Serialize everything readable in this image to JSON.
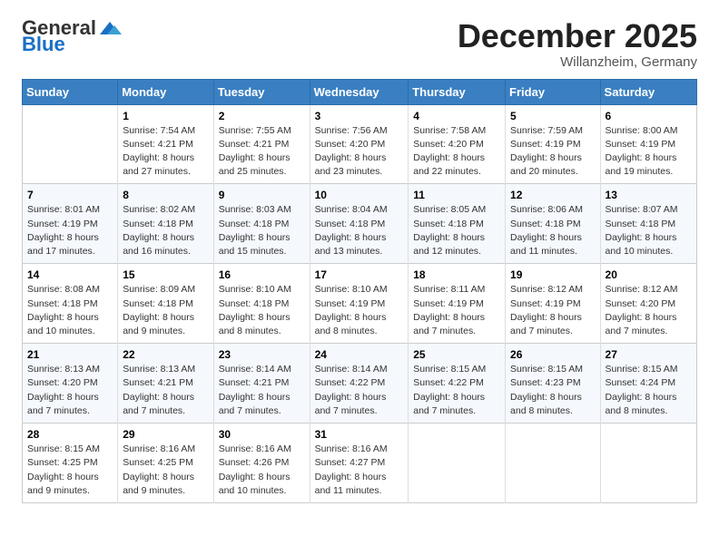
{
  "header": {
    "logo_general": "General",
    "logo_blue": "Blue",
    "month_title": "December 2025",
    "location": "Willanzheim, Germany"
  },
  "days_of_week": [
    "Sunday",
    "Monday",
    "Tuesday",
    "Wednesday",
    "Thursday",
    "Friday",
    "Saturday"
  ],
  "weeks": [
    [
      {
        "day": "",
        "sunrise": "",
        "sunset": "",
        "daylight": ""
      },
      {
        "day": "1",
        "sunrise": "Sunrise: 7:54 AM",
        "sunset": "Sunset: 4:21 PM",
        "daylight": "Daylight: 8 hours and 27 minutes."
      },
      {
        "day": "2",
        "sunrise": "Sunrise: 7:55 AM",
        "sunset": "Sunset: 4:21 PM",
        "daylight": "Daylight: 8 hours and 25 minutes."
      },
      {
        "day": "3",
        "sunrise": "Sunrise: 7:56 AM",
        "sunset": "Sunset: 4:20 PM",
        "daylight": "Daylight: 8 hours and 23 minutes."
      },
      {
        "day": "4",
        "sunrise": "Sunrise: 7:58 AM",
        "sunset": "Sunset: 4:20 PM",
        "daylight": "Daylight: 8 hours and 22 minutes."
      },
      {
        "day": "5",
        "sunrise": "Sunrise: 7:59 AM",
        "sunset": "Sunset: 4:19 PM",
        "daylight": "Daylight: 8 hours and 20 minutes."
      },
      {
        "day": "6",
        "sunrise": "Sunrise: 8:00 AM",
        "sunset": "Sunset: 4:19 PM",
        "daylight": "Daylight: 8 hours and 19 minutes."
      }
    ],
    [
      {
        "day": "7",
        "sunrise": "Sunrise: 8:01 AM",
        "sunset": "Sunset: 4:19 PM",
        "daylight": "Daylight: 8 hours and 17 minutes."
      },
      {
        "day": "8",
        "sunrise": "Sunrise: 8:02 AM",
        "sunset": "Sunset: 4:18 PM",
        "daylight": "Daylight: 8 hours and 16 minutes."
      },
      {
        "day": "9",
        "sunrise": "Sunrise: 8:03 AM",
        "sunset": "Sunset: 4:18 PM",
        "daylight": "Daylight: 8 hours and 15 minutes."
      },
      {
        "day": "10",
        "sunrise": "Sunrise: 8:04 AM",
        "sunset": "Sunset: 4:18 PM",
        "daylight": "Daylight: 8 hours and 13 minutes."
      },
      {
        "day": "11",
        "sunrise": "Sunrise: 8:05 AM",
        "sunset": "Sunset: 4:18 PM",
        "daylight": "Daylight: 8 hours and 12 minutes."
      },
      {
        "day": "12",
        "sunrise": "Sunrise: 8:06 AM",
        "sunset": "Sunset: 4:18 PM",
        "daylight": "Daylight: 8 hours and 11 minutes."
      },
      {
        "day": "13",
        "sunrise": "Sunrise: 8:07 AM",
        "sunset": "Sunset: 4:18 PM",
        "daylight": "Daylight: 8 hours and 10 minutes."
      }
    ],
    [
      {
        "day": "14",
        "sunrise": "Sunrise: 8:08 AM",
        "sunset": "Sunset: 4:18 PM",
        "daylight": "Daylight: 8 hours and 10 minutes."
      },
      {
        "day": "15",
        "sunrise": "Sunrise: 8:09 AM",
        "sunset": "Sunset: 4:18 PM",
        "daylight": "Daylight: 8 hours and 9 minutes."
      },
      {
        "day": "16",
        "sunrise": "Sunrise: 8:10 AM",
        "sunset": "Sunset: 4:18 PM",
        "daylight": "Daylight: 8 hours and 8 minutes."
      },
      {
        "day": "17",
        "sunrise": "Sunrise: 8:10 AM",
        "sunset": "Sunset: 4:19 PM",
        "daylight": "Daylight: 8 hours and 8 minutes."
      },
      {
        "day": "18",
        "sunrise": "Sunrise: 8:11 AM",
        "sunset": "Sunset: 4:19 PM",
        "daylight": "Daylight: 8 hours and 7 minutes."
      },
      {
        "day": "19",
        "sunrise": "Sunrise: 8:12 AM",
        "sunset": "Sunset: 4:19 PM",
        "daylight": "Daylight: 8 hours and 7 minutes."
      },
      {
        "day": "20",
        "sunrise": "Sunrise: 8:12 AM",
        "sunset": "Sunset: 4:20 PM",
        "daylight": "Daylight: 8 hours and 7 minutes."
      }
    ],
    [
      {
        "day": "21",
        "sunrise": "Sunrise: 8:13 AM",
        "sunset": "Sunset: 4:20 PM",
        "daylight": "Daylight: 8 hours and 7 minutes."
      },
      {
        "day": "22",
        "sunrise": "Sunrise: 8:13 AM",
        "sunset": "Sunset: 4:21 PM",
        "daylight": "Daylight: 8 hours and 7 minutes."
      },
      {
        "day": "23",
        "sunrise": "Sunrise: 8:14 AM",
        "sunset": "Sunset: 4:21 PM",
        "daylight": "Daylight: 8 hours and 7 minutes."
      },
      {
        "day": "24",
        "sunrise": "Sunrise: 8:14 AM",
        "sunset": "Sunset: 4:22 PM",
        "daylight": "Daylight: 8 hours and 7 minutes."
      },
      {
        "day": "25",
        "sunrise": "Sunrise: 8:15 AM",
        "sunset": "Sunset: 4:22 PM",
        "daylight": "Daylight: 8 hours and 7 minutes."
      },
      {
        "day": "26",
        "sunrise": "Sunrise: 8:15 AM",
        "sunset": "Sunset: 4:23 PM",
        "daylight": "Daylight: 8 hours and 8 minutes."
      },
      {
        "day": "27",
        "sunrise": "Sunrise: 8:15 AM",
        "sunset": "Sunset: 4:24 PM",
        "daylight": "Daylight: 8 hours and 8 minutes."
      }
    ],
    [
      {
        "day": "28",
        "sunrise": "Sunrise: 8:15 AM",
        "sunset": "Sunset: 4:25 PM",
        "daylight": "Daylight: 8 hours and 9 minutes."
      },
      {
        "day": "29",
        "sunrise": "Sunrise: 8:16 AM",
        "sunset": "Sunset: 4:25 PM",
        "daylight": "Daylight: 8 hours and 9 minutes."
      },
      {
        "day": "30",
        "sunrise": "Sunrise: 8:16 AM",
        "sunset": "Sunset: 4:26 PM",
        "daylight": "Daylight: 8 hours and 10 minutes."
      },
      {
        "day": "31",
        "sunrise": "Sunrise: 8:16 AM",
        "sunset": "Sunset: 4:27 PM",
        "daylight": "Daylight: 8 hours and 11 minutes."
      },
      {
        "day": "",
        "sunrise": "",
        "sunset": "",
        "daylight": ""
      },
      {
        "day": "",
        "sunrise": "",
        "sunset": "",
        "daylight": ""
      },
      {
        "day": "",
        "sunrise": "",
        "sunset": "",
        "daylight": ""
      }
    ]
  ]
}
